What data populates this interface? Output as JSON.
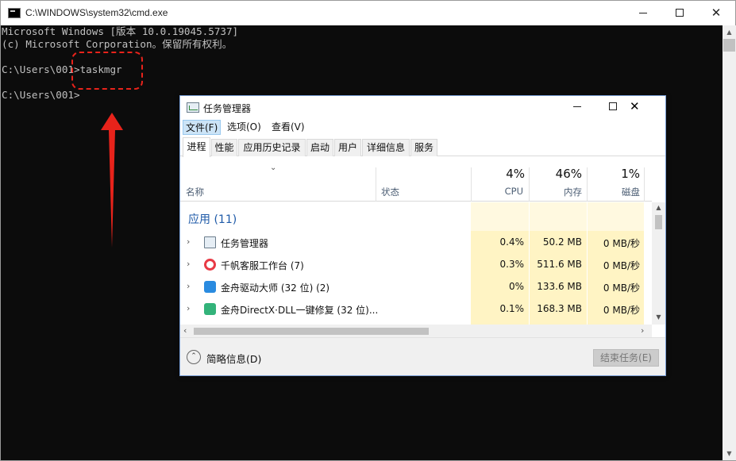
{
  "cmd": {
    "title": "C:\\WINDOWS\\system32\\cmd.exe",
    "lines": [
      "Microsoft Windows [版本 10.0.19045.5737]",
      "(c) Microsoft Corporation。保留所有权利。",
      "C:\\Users\\001>taskmgr",
      "C:\\Users\\001>"
    ]
  },
  "annotation": {
    "color": "#e8231b"
  },
  "task_manager": {
    "title": "任务管理器",
    "menu": [
      "文件(F)",
      "选项(O)",
      "查看(V)"
    ],
    "tabs": [
      "进程",
      "性能",
      "应用历史记录",
      "启动",
      "用户",
      "详细信息",
      "服务"
    ],
    "active_tab": "进程",
    "columns": {
      "name": "名称",
      "status": "状态",
      "cpu": {
        "label": "CPU",
        "percent": "4%"
      },
      "memory": {
        "label": "内存",
        "percent": "46%"
      },
      "disk": {
        "label": "磁盘",
        "percent": "1%"
      }
    },
    "group": "应用 (11)",
    "rows": [
      {
        "name": "任务管理器",
        "icon": "task-manager-icon",
        "cpu": "0.4%",
        "memory": "50.2 MB",
        "disk": "0 MB/秒"
      },
      {
        "name": "千帆客服工作台 (7)",
        "icon": "qianfan-icon",
        "cpu": "0.3%",
        "memory": "511.6 MB",
        "disk": "0 MB/秒"
      },
      {
        "name": "金舟驱动大师 (32 位) (2)",
        "icon": "driver-master-icon",
        "cpu": "0%",
        "memory": "133.6 MB",
        "disk": "0 MB/秒"
      },
      {
        "name": "金舟DirectX·DLL一键修复 (32 位)...",
        "icon": "dll-repair-icon",
        "cpu": "0.1%",
        "memory": "168.3 MB",
        "disk": "0 MB/秒"
      }
    ],
    "footer": {
      "fewer_details": "简略信息(D)",
      "end_task": "结束任务(E)"
    }
  }
}
